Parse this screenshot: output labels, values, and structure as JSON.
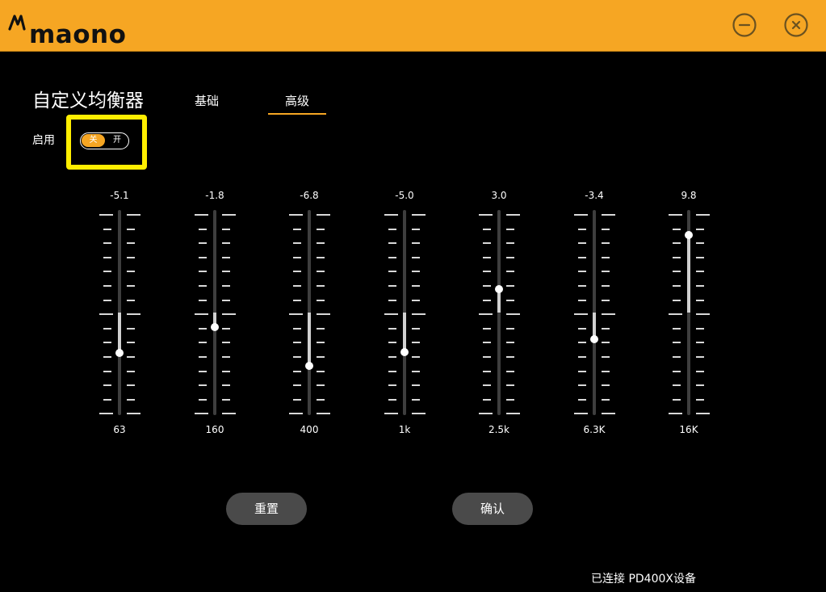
{
  "app": {
    "logo_text": "maono",
    "colors": {
      "accent": "#f6a623",
      "highlight": "#ffee00",
      "background": "#000000",
      "button": "#4a4a4a"
    }
  },
  "window_controls": {
    "minimize_icon": "minimize-icon",
    "close_icon": "close-icon"
  },
  "title": "自定义均衡器",
  "tabs": [
    {
      "label": "基础",
      "active": false
    },
    {
      "label": "高级",
      "active": true
    }
  ],
  "enable": {
    "label": "启用",
    "off_label": "关",
    "on_label": "开",
    "state": "off"
  },
  "eq": {
    "range": [
      -12,
      12
    ],
    "bands": [
      {
        "freq": "63",
        "value": "-5.1"
      },
      {
        "freq": "160",
        "value": "-1.8"
      },
      {
        "freq": "400",
        "value": "-6.8"
      },
      {
        "freq": "1k",
        "value": "-5.0"
      },
      {
        "freq": "2.5k",
        "value": "3.0"
      },
      {
        "freq": "6.3K",
        "value": "-3.4"
      },
      {
        "freq": "16K",
        "value": "9.8"
      }
    ]
  },
  "buttons": {
    "reset": "重置",
    "confirm": "确认"
  },
  "status": "已连接 PD400X设备"
}
